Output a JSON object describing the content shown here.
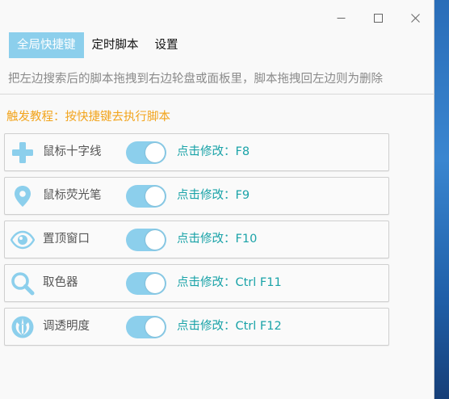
{
  "window": {
    "controls": {
      "minimize": "—",
      "maximize": "☐",
      "close": "✕"
    }
  },
  "tabs": [
    {
      "label": "全局快捷键",
      "active": true
    },
    {
      "label": "定时脚本",
      "active": false
    },
    {
      "label": "设置",
      "active": false
    }
  ],
  "hint": "把左边搜索后的脚本拖拽到右边轮盘或面板里，脚本拖拽回左边则为删除",
  "tutorial": "触发教程：按快捷键去执行脚本",
  "colors": {
    "accent": "#8ccfec",
    "hotkey_text": "#1aa3a8",
    "tutorial_text": "#f2a41c"
  },
  "scripts": [
    {
      "icon": "plus-icon",
      "label": "鼠标十字线",
      "enabled": true,
      "hotkey": "点击修改：F8"
    },
    {
      "icon": "map-pin-icon",
      "label": "鼠标荧光笔",
      "enabled": true,
      "hotkey": "点击修改：F9"
    },
    {
      "icon": "eye-icon",
      "label": "置顶窗口",
      "enabled": true,
      "hotkey": "点击修改：F10"
    },
    {
      "icon": "magnifier-icon",
      "label": "取色器",
      "enabled": true,
      "hotkey": "点击修改：Ctrl F11"
    },
    {
      "icon": "rebel-emblem-icon",
      "label": "调透明度",
      "enabled": true,
      "hotkey": "点击修改：Ctrl F12"
    }
  ]
}
